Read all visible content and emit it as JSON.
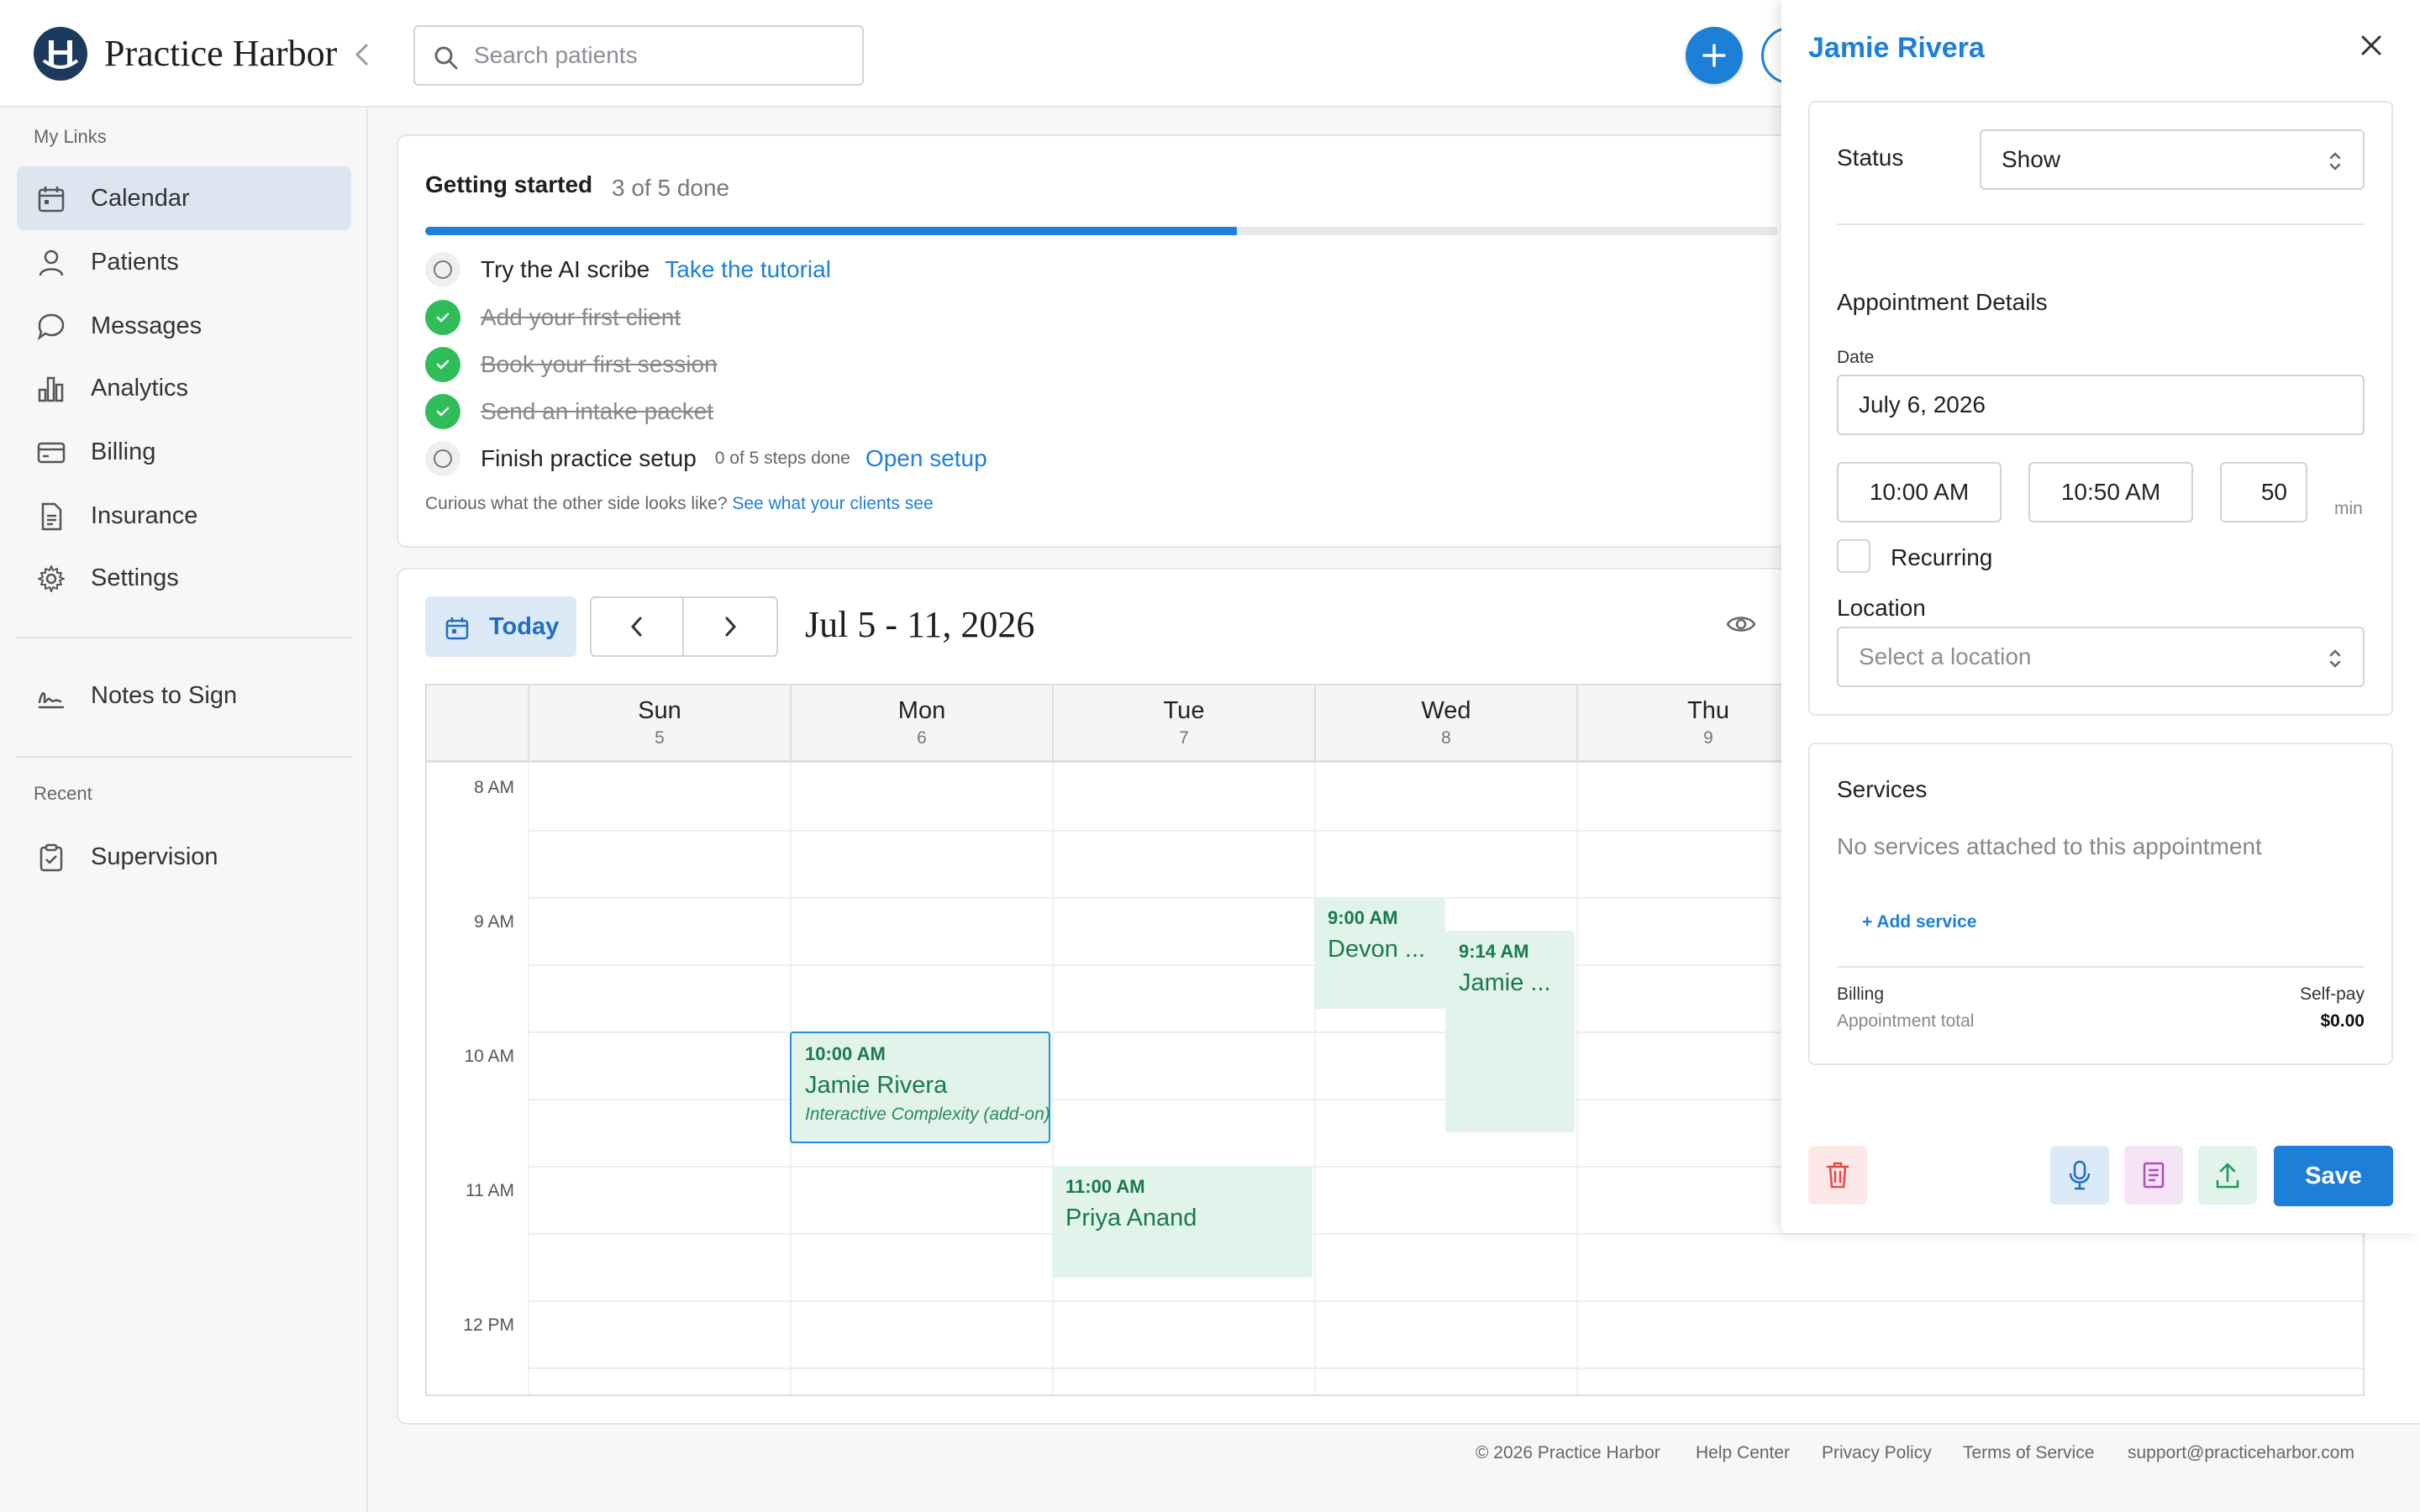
{
  "brand": {
    "name": "Practice Harbor"
  },
  "search": {
    "placeholder": "Search patients"
  },
  "sidebar": {
    "my_links_label": "My Links",
    "items": [
      {
        "label": "Calendar",
        "icon": "calendar-icon",
        "active": true
      },
      {
        "label": "Patients",
        "icon": "user-icon"
      },
      {
        "label": "Messages",
        "icon": "chat-icon"
      },
      {
        "label": "Analytics",
        "icon": "bar-chart-icon"
      },
      {
        "label": "Billing",
        "icon": "credit-card-icon"
      },
      {
        "label": "Insurance",
        "icon": "document-icon"
      },
      {
        "label": "Settings",
        "icon": "gear-icon"
      }
    ],
    "notes_to_sign": "Notes to Sign",
    "recent_label": "Recent",
    "recent_items": [
      {
        "label": "Supervision",
        "icon": "clipboard-icon"
      }
    ]
  },
  "getting_started": {
    "title": "Getting started",
    "progress_text": "3 of 5 done",
    "progress_fraction": 0.6,
    "steps": [
      {
        "label": "Try the AI scribe",
        "done": false,
        "link": "Take the tutorial"
      },
      {
        "label": "Add your first client",
        "done": true
      },
      {
        "label": "Book your first session",
        "done": true
      },
      {
        "label": "Send an intake packet",
        "done": true
      },
      {
        "label": "Finish practice setup",
        "done": false,
        "sub": "0 of 5 steps done",
        "link": "Open setup"
      }
    ],
    "footer_text": "Curious what the other side looks like?",
    "footer_link": "See what your clients see"
  },
  "calendar": {
    "today_label": "Today",
    "range_title": "Jul 5 - 11, 2026",
    "days": [
      {
        "name": "Sun",
        "date": "5"
      },
      {
        "name": "Mon",
        "date": "6"
      },
      {
        "name": "Tue",
        "date": "7"
      },
      {
        "name": "Wed",
        "date": "8"
      },
      {
        "name": "Thu",
        "date": "9"
      }
    ],
    "hours": [
      "8 AM",
      "9 AM",
      "10 AM",
      "11 AM",
      "12 PM"
    ],
    "appointments": [
      {
        "time": "9:00 AM",
        "name": "Devon ...",
        "day": 3,
        "start": 9.0,
        "end": 9.83
      },
      {
        "time": "9:14 AM",
        "name": "Jamie ...",
        "day": 3,
        "start": 9.25,
        "end": 10.75,
        "offset": true
      },
      {
        "time": "10:00 AM",
        "name": "Jamie Rivera",
        "service": "Interactive Complexity (add-on)",
        "day": 1,
        "start": 10.0,
        "end": 10.83,
        "selected": true
      },
      {
        "time": "11:00 AM",
        "name": "Priya Anand",
        "day": 2,
        "start": 11.0,
        "end": 11.83
      }
    ]
  },
  "footer": {
    "copyright": "© 2026 Practice Harbor",
    "links": [
      "Help Center",
      "Privacy Policy",
      "Terms of Service",
      "support@practiceharbor.com"
    ]
  },
  "drawer": {
    "title": "Jamie Rivera",
    "status_label": "Status",
    "status_value": "Show",
    "details_title": "Appointment Details",
    "date_label": "Date",
    "date_value": "July 6, 2026",
    "start_time": "10:00 AM",
    "end_time": "10:50 AM",
    "duration": "50",
    "duration_unit": "min",
    "recurring_label": "Recurring",
    "location_label": "Location",
    "location_placeholder": "Select a location",
    "services_title": "Services",
    "no_services": "No services attached to this appointment",
    "add_service": "+ Add service",
    "billing_label": "Billing",
    "billing_value": "Self-pay",
    "total_label": "Appointment total",
    "total_value": "$0.00",
    "save_label": "Save"
  },
  "colors": {
    "accent": "#1e7fd8",
    "success": "#2ebd59",
    "appointment_bg": "#e1f3ea",
    "appointment_text": "#1a7a4c"
  }
}
